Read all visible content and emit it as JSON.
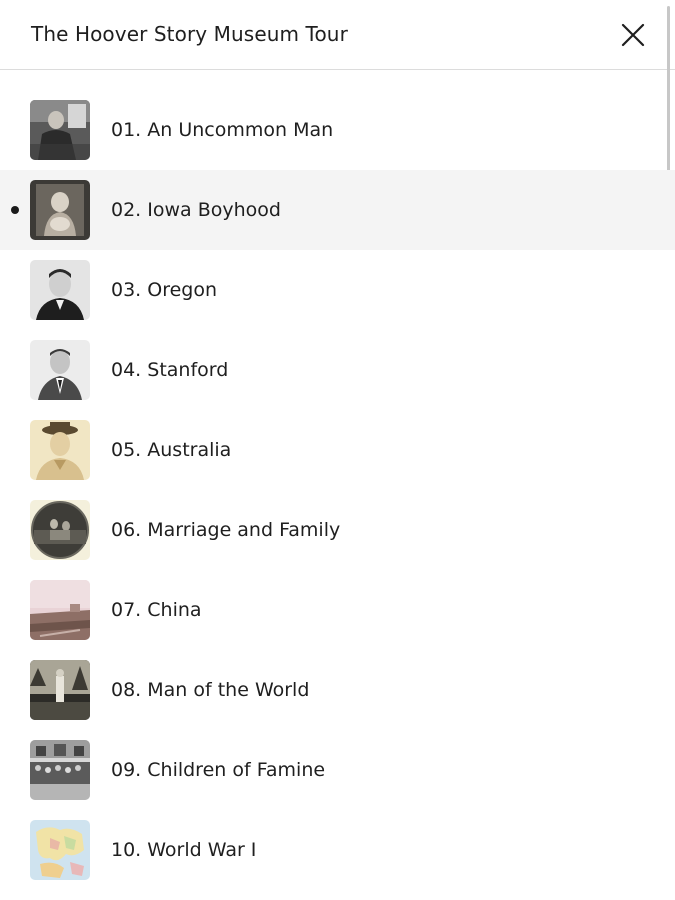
{
  "header": {
    "title": "The Hoover Story Museum Tour",
    "close_icon": "close-icon"
  },
  "tour": {
    "items": [
      {
        "label": "01. An Uncommon Man",
        "active": false,
        "photo": "hoover-portrait-seated"
      },
      {
        "label": "02. Iowa Boyhood",
        "active": true,
        "photo": "child-portrait-sepia"
      },
      {
        "label": "03. Oregon",
        "active": false,
        "photo": "young-man-portrait-bw"
      },
      {
        "label": "04. Stanford",
        "active": false,
        "photo": "student-portrait-bw"
      },
      {
        "label": "05. Australia",
        "active": false,
        "photo": "man-with-hat-sepia"
      },
      {
        "label": "06. Marriage and Family",
        "active": false,
        "photo": "family-photo-oval"
      },
      {
        "label": "07. China",
        "active": false,
        "photo": "landscape-pink-tint"
      },
      {
        "label": "08. Man of the World",
        "active": false,
        "photo": "figure-in-doorway"
      },
      {
        "label": "09. Children of Famine",
        "active": false,
        "photo": "crowd-of-children"
      },
      {
        "label": "10. World War I",
        "active": false,
        "photo": "map-of-europe"
      }
    ]
  },
  "colors": {
    "active_row": "#f4f4f4",
    "divider": "#dcdcdc",
    "text": "#1f1f1f"
  }
}
